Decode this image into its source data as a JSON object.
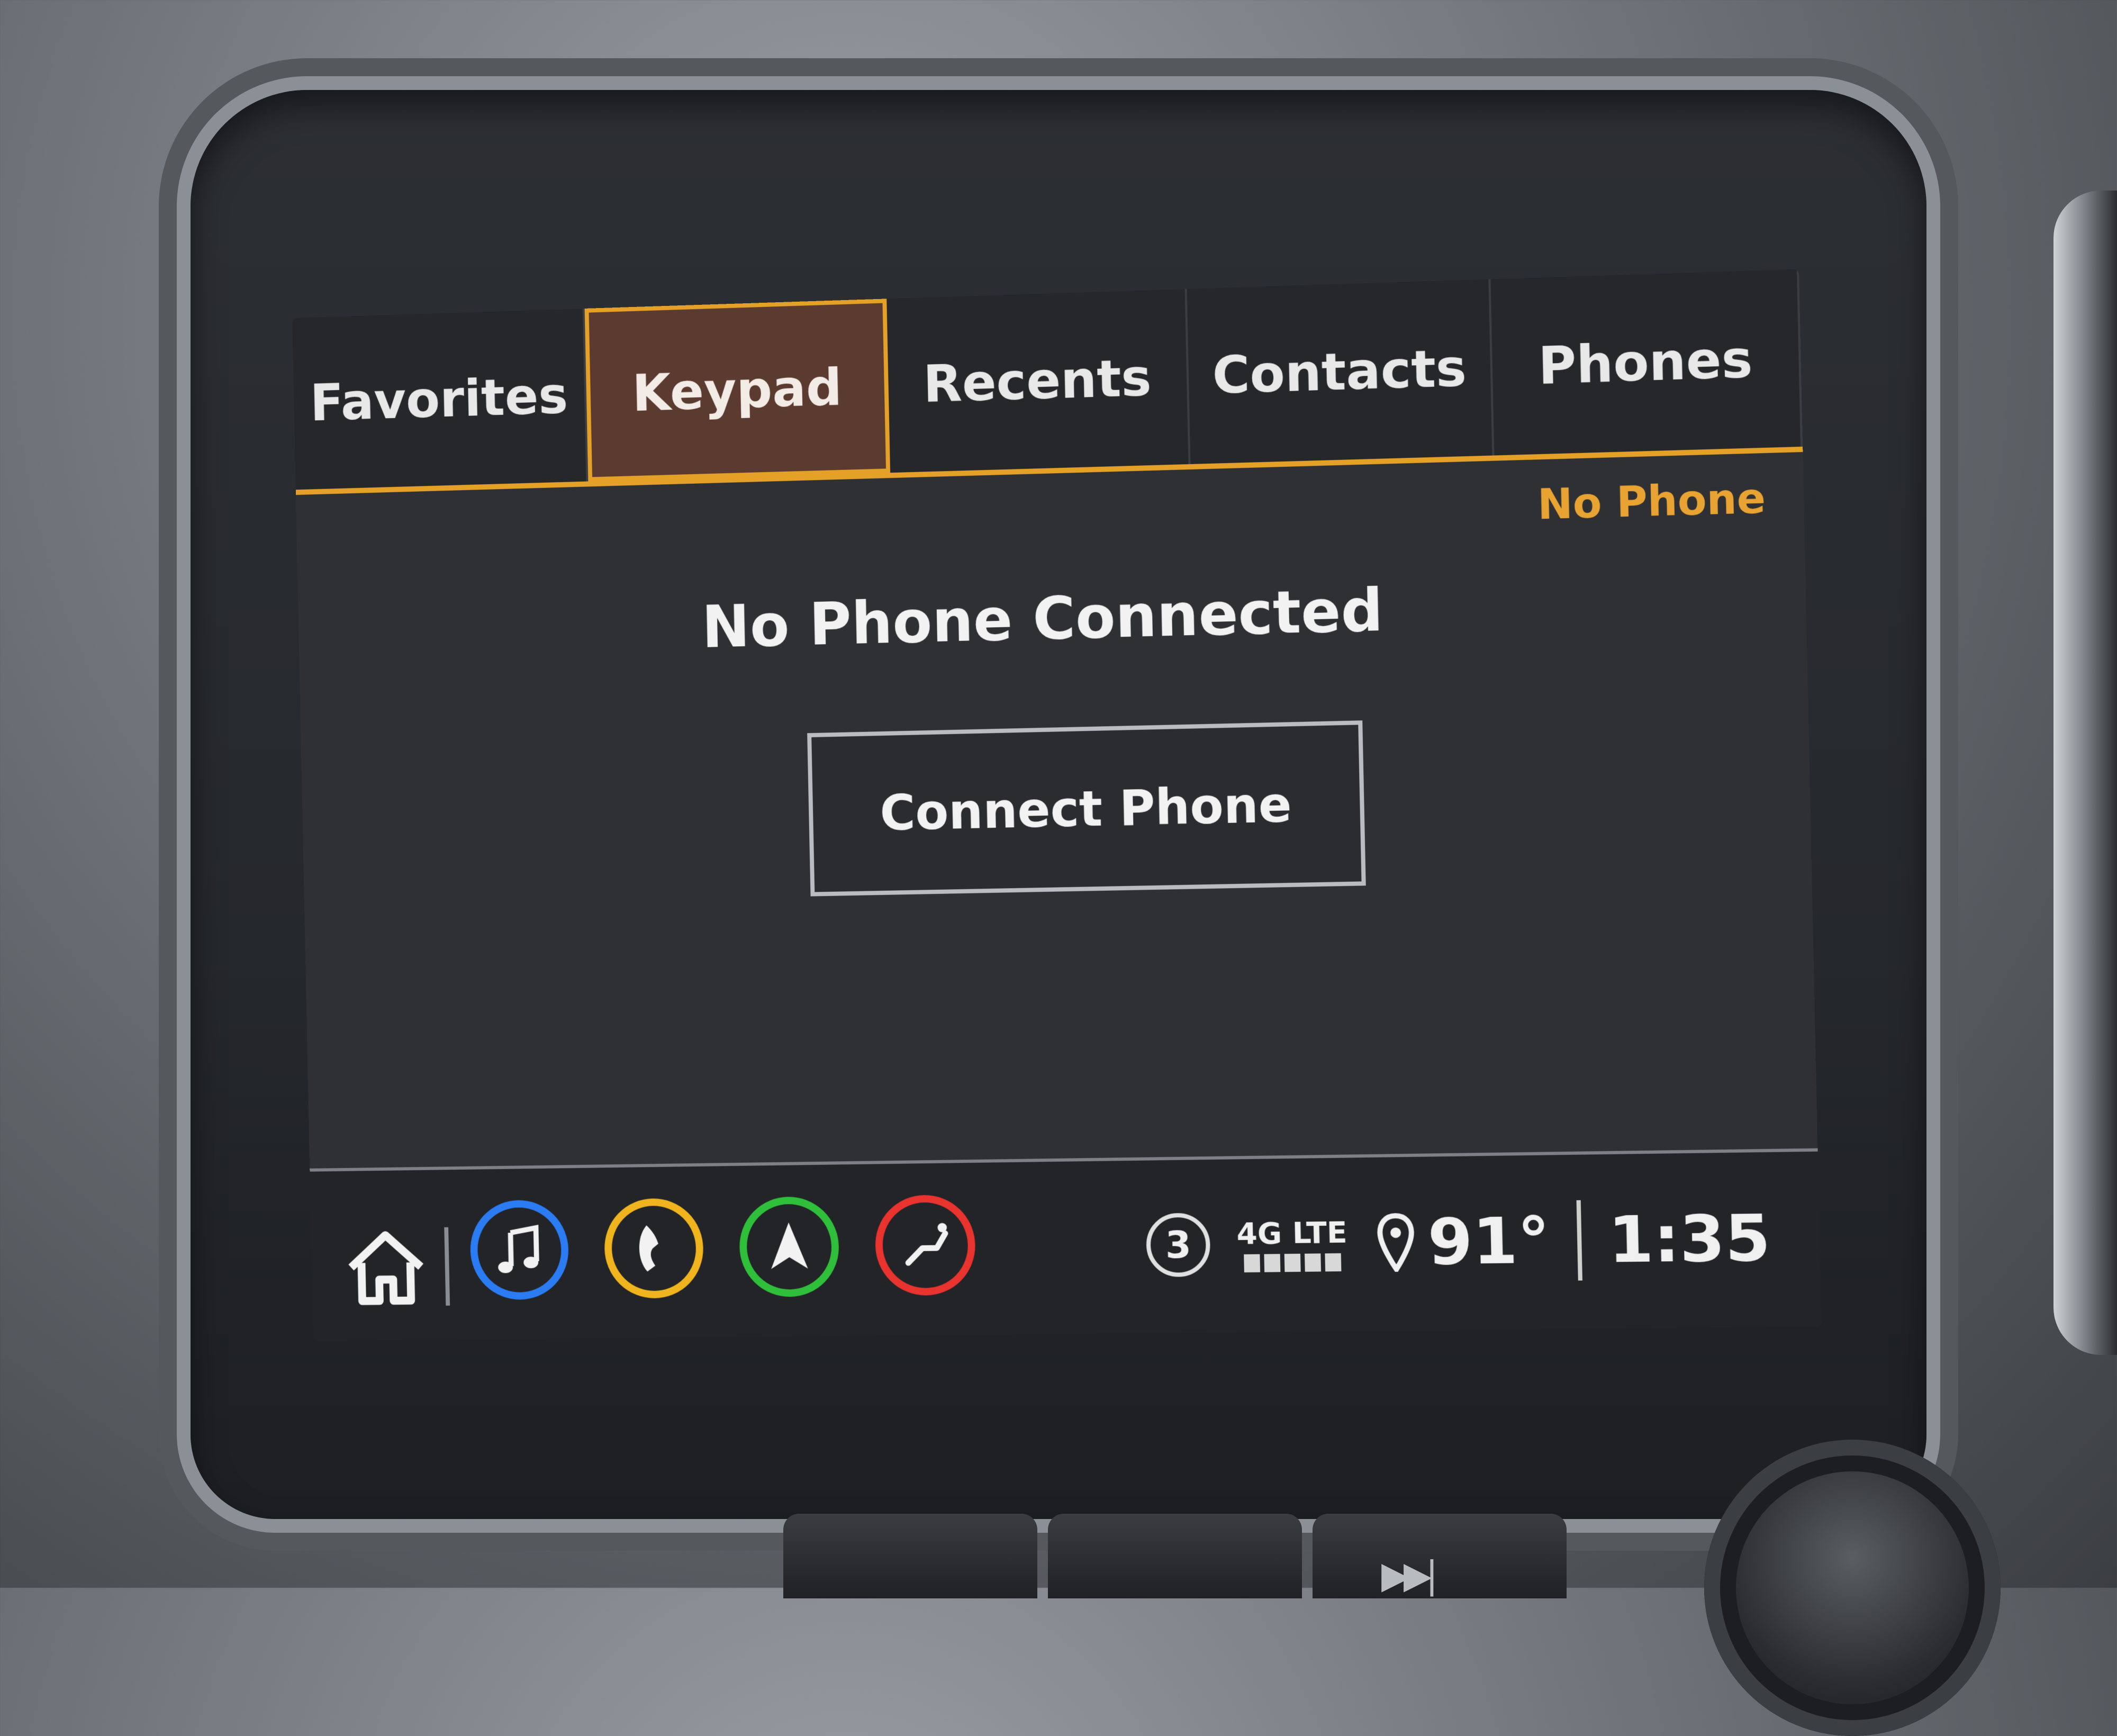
{
  "tabs": [
    "Favorites",
    "Keypad",
    "Recents",
    "Contacts",
    "Phones"
  ],
  "active_tab": "Keypad",
  "phone_status": "No Phone",
  "main": {
    "title": "No Phone Connected",
    "connect_button": "Connect Phone"
  },
  "bottom_apps": [
    {
      "name": "home-icon"
    },
    {
      "name": "music-icon",
      "color": "#2b7bf3"
    },
    {
      "name": "phone-icon",
      "color": "#f0b51e"
    },
    {
      "name": "navigation-icon",
      "color": "#2fbf3a"
    },
    {
      "name": "seat-icon",
      "color": "#e8332f"
    }
  ],
  "status": {
    "notifications": "3",
    "network": "4G LTE",
    "temperature": "91°",
    "time": "1:35"
  },
  "colors": {
    "accent": "#e5a028",
    "active_tab_bg": "#5b3a2f"
  }
}
